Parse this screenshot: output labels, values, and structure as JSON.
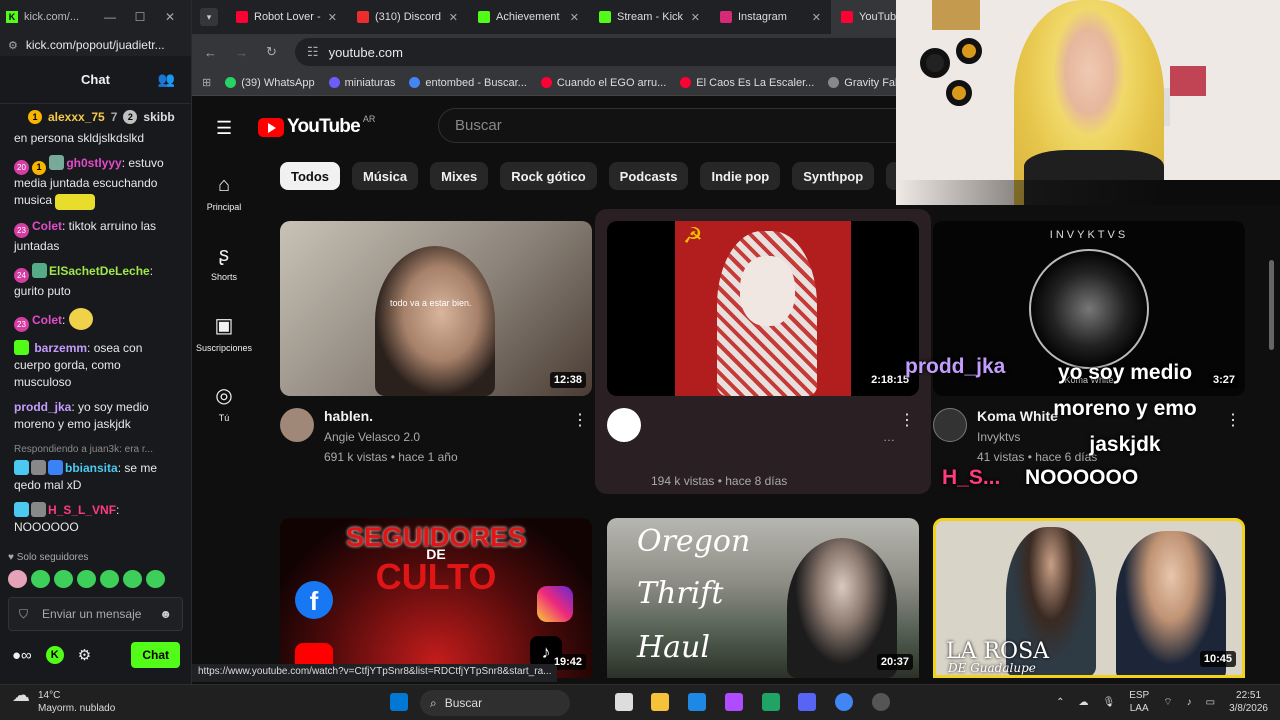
{
  "kick": {
    "window_title": "kick.com/...",
    "url": "kick.com/popout/juadietr...",
    "header": "Chat",
    "pinned": {
      "user1": "alexxx_75",
      "rank1": "7",
      "user2": "skibb"
    },
    "messages": [
      {
        "user": "",
        "text": "en persona skldjslkdslkd"
      },
      {
        "badge": "20",
        "user": "gh0stlyyy",
        "user_color": "#e24cc9",
        "text": "estuvo media juntada escuchando musica"
      },
      {
        "badge": "23",
        "user": "Colet",
        "user_color": "#e24cc9",
        "text": "tiktok arruino las juntadas"
      },
      {
        "badge": "24",
        "user": "ElSachetDeLeche",
        "user_color": "#9fe84c",
        "text": "gurito puto"
      },
      {
        "badge": "23",
        "user": "Colet",
        "user_color": "#e24cc9",
        "text": ""
      },
      {
        "badge": "",
        "user": "barzemm",
        "user_color": "#c39dfc",
        "text": "osea con cuerpo gorda, como musculoso"
      },
      {
        "badge": "",
        "user": "prodd_jka",
        "user_color": "#c39dfc",
        "text": "yo soy medio moreno y emo jaskjdk"
      },
      {
        "reply": "Respondiendo a juan3k: era r...",
        "user": "bbiansita",
        "user_color": "#4cc9f0",
        "text": "se me qedo mal xD"
      },
      {
        "user": "H_S_L_VNF",
        "user_color": "#ff3b7f",
        "text": "NOOOOOO"
      }
    ],
    "followers_only": "Solo seguidores",
    "input_placeholder": "Enviar un mensaje",
    "chat_button": "Chat"
  },
  "browser": {
    "tabs": [
      {
        "title": "Robot Lover -",
        "icon_color": "#ff0033"
      },
      {
        "title": "(310) Discord",
        "icon_color": "#ed2d2d"
      },
      {
        "title": "Achievement",
        "icon_color": "#53fc18"
      },
      {
        "title": "Stream - Kick",
        "icon_color": "#53fc18"
      },
      {
        "title": "Instagram",
        "icon_color": "#d62976"
      },
      {
        "title": "YouTube",
        "icon_color": "#ff0033"
      }
    ],
    "url": "youtube.com",
    "bookmarks": [
      {
        "label": "(39) WhatsApp",
        "icon_color": "#25d366"
      },
      {
        "label": "miniaturas",
        "icon_color": "#6d5dfc"
      },
      {
        "label": "entombed - Buscar...",
        "icon_color": "#4285f4"
      },
      {
        "label": "Cuando el EGO arru...",
        "icon_color": "#ff0033"
      },
      {
        "label": "El Caos Es La Escaler...",
        "icon_color": "#ff0033"
      },
      {
        "label": "Gravity Falls Full E",
        "icon_color": "#888888"
      }
    ],
    "status_url": "https://www.youtube.com/watch?v=CtfjYTpSnr8&list=RDCtfjYTpSnr8&start_ra..."
  },
  "youtube": {
    "logo_text": "YouTube",
    "country": "AR",
    "search_placeholder": "Buscar",
    "sidebar": [
      {
        "label": "Principal",
        "icon": "home-icon"
      },
      {
        "label": "Shorts",
        "icon": "shorts-icon"
      },
      {
        "label": "Suscripciones",
        "icon": "subscriptions-icon"
      },
      {
        "label": "Tú",
        "icon": "you-icon"
      }
    ],
    "chips": [
      "Todos",
      "Música",
      "Mixes",
      "Rock gótico",
      "Podcasts",
      "Indie pop",
      "Synthpop",
      "En tie"
    ],
    "videos": [
      {
        "title": "hablen.",
        "channel": "Angie Velasco 2.0",
        "stats": "691 k vistas • hace 1 año",
        "duration": "12:38",
        "thumb_caption": "todo va a estar bien."
      },
      {
        "title": "",
        "channel": "",
        "stats": "194 k vistas • hace 8 días",
        "duration": "2:18:15"
      },
      {
        "title": "Koma White",
        "channel": "Invyktvs",
        "stats": "41 vistas • hace 6 días",
        "duration": "3:27",
        "thumb_caption": "INVYKTVS",
        "thumb_sub": "Koma White"
      },
      {
        "duration": "19:42",
        "thumb_caption": "SEGUIDORES",
        "thumb_sub": "DE",
        "thumb_sub2": "CULTO"
      },
      {
        "duration": "20:37",
        "thumb_caption": "Oregon",
        "thumb_sub": "Thrift",
        "thumb_sub2": "Haul"
      },
      {
        "duration": "10:45",
        "thumb_caption": "LA ROSA",
        "thumb_sub": "DE Guadalupe"
      }
    ]
  },
  "overlay": {
    "user": "prodd_jka",
    "message": "yo soy medio moreno y emo jaskjdk",
    "user2": "H_S...",
    "message2": "NOOOOOO"
  },
  "taskbar": {
    "temp": "14°C",
    "weather": "Mayorm. nublado",
    "search": "Buscar",
    "lang1": "ESP",
    "lang2": "LAA",
    "time": "22:51",
    "date": "3/8/2026"
  }
}
